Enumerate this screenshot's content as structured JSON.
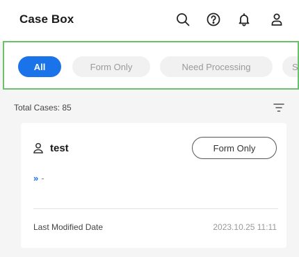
{
  "header": {
    "title": "Case Box",
    "icons": [
      "search-icon",
      "help-icon",
      "bell-icon",
      "user-icon"
    ]
  },
  "filters": {
    "chips": [
      {
        "label": "All",
        "active": true
      },
      {
        "label": "Form Only",
        "active": false
      },
      {
        "label": "Need Processing",
        "active": false
      },
      {
        "label": "S",
        "active": false
      }
    ]
  },
  "summary": {
    "total_label": "Total Cases: 85"
  },
  "cases": [
    {
      "name": "test",
      "status": "Form Only",
      "progress_glyph": "»",
      "progress_value": "-",
      "modified_label": "Last Modified Date",
      "modified_value": "2023.10.25 11:11"
    }
  ],
  "colors": {
    "accent": "#1a73e8",
    "highlight_border": "#6cc06c",
    "background": "#f5f5f5"
  }
}
